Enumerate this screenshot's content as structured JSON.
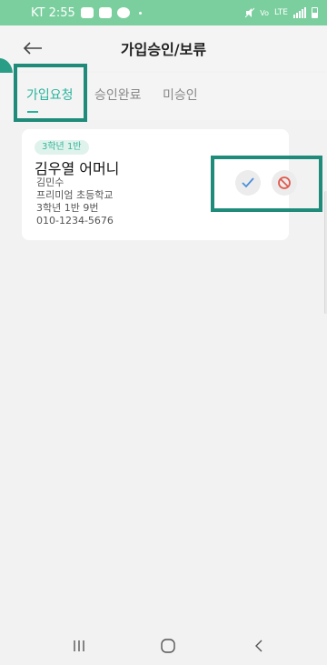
{
  "status_bar": {
    "carrier_time": "KT 2:55",
    "network": "LTE",
    "icons": [
      "notification-icon",
      "gallery-icon",
      "cloud-icon",
      "mute-icon",
      "wifi-call-icon",
      "signal-icon",
      "battery-icon"
    ]
  },
  "header": {
    "back_icon": "back-arrow-icon",
    "title": "가입승인/보류"
  },
  "tabs": [
    {
      "label": "가입요청",
      "active": true
    },
    {
      "label": "승인완료",
      "active": false
    },
    {
      "label": "미승인",
      "active": false
    }
  ],
  "request_card": {
    "badge": "3학년 1반",
    "name": "김우열 어머니",
    "child_name": "김민수",
    "school": "프리미엄 초등학교",
    "class_info": "3학년 1반 9번",
    "phone": "010-1234-5676",
    "approve_icon": "check-icon",
    "reject_icon": "prohibit-icon"
  },
  "colors": {
    "accent": "#27b39b",
    "status_bar": "#7bcf9e",
    "highlight": "#1f8b7a",
    "approve": "#4a90d9",
    "reject": "#e05a4e"
  },
  "nav_bar": {
    "icons": [
      "recent-apps-icon",
      "home-icon",
      "back-icon"
    ]
  }
}
